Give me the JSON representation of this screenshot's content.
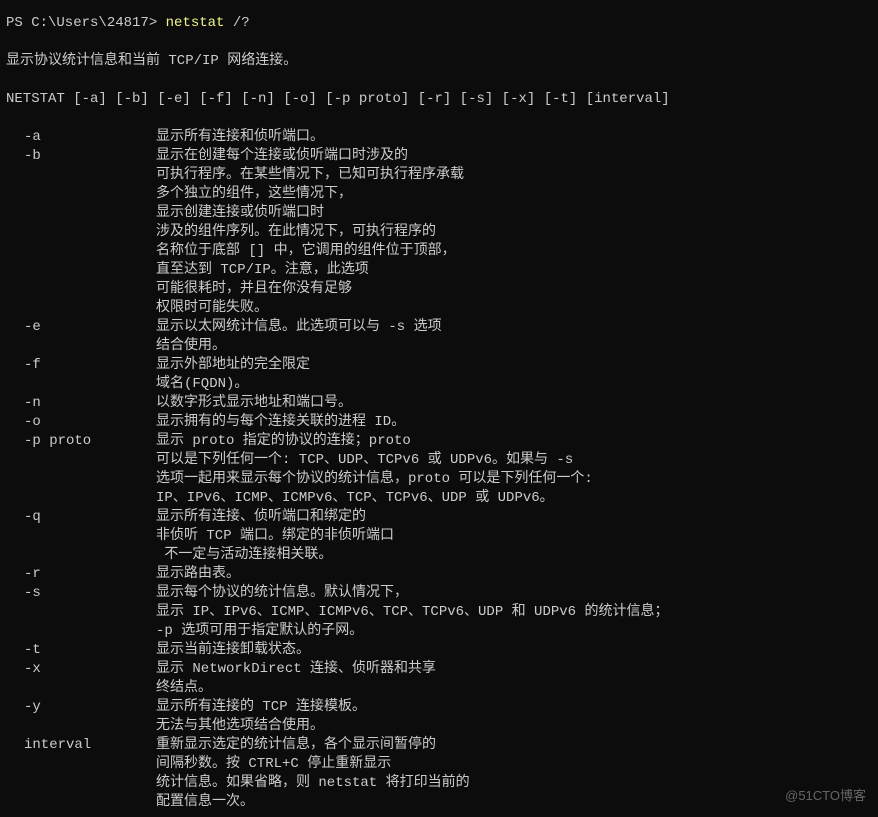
{
  "prompt": {
    "prefix": "PS C:\\Users\\24817> ",
    "command": "netstat",
    "args": " /?"
  },
  "summary": "显示协议统计信息和当前 TCP/IP 网络连接。",
  "usage": "NETSTAT [-a] [-b] [-e] [-f] [-n] [-o] [-p proto] [-r] [-s] [-x] [-t] [interval]",
  "options": {
    "a": {
      "flag": "-a",
      "lines": [
        "显示所有连接和侦听端口。"
      ]
    },
    "b": {
      "flag": "-b",
      "lines": [
        "显示在创建每个连接或侦听端口时涉及的",
        "可执行程序。在某些情况下，已知可执行程序承载",
        "多个独立的组件，这些情况下，",
        "显示创建连接或侦听端口时",
        "涉及的组件序列。在此情况下，可执行程序的",
        "名称位于底部 [] 中，它调用的组件位于顶部，",
        "直至达到 TCP/IP。注意，此选项",
        "可能很耗时，并且在你没有足够",
        "权限时可能失败。"
      ]
    },
    "e": {
      "flag": "-e",
      "lines": [
        "显示以太网统计信息。此选项可以与 -s 选项",
        "结合使用。"
      ]
    },
    "f": {
      "flag": "-f",
      "lines": [
        "显示外部地址的完全限定",
        "域名(FQDN)。"
      ]
    },
    "n": {
      "flag": "-n",
      "lines": [
        "以数字形式显示地址和端口号。"
      ]
    },
    "o": {
      "flag": "-o",
      "lines": [
        "显示拥有的与每个连接关联的进程 ID。"
      ]
    },
    "p": {
      "flag": "-p proto",
      "lines": [
        "显示 proto 指定的协议的连接；proto",
        "可以是下列任何一个: TCP、UDP、TCPv6 或 UDPv6。如果与 -s",
        "选项一起用来显示每个协议的统计信息，proto 可以是下列任何一个:",
        "IP、IPv6、ICMP、ICMPv6、TCP、TCPv6、UDP 或 UDPv6。"
      ]
    },
    "q": {
      "flag": "-q",
      "lines": [
        "显示所有连接、侦听端口和绑定的",
        "非侦听 TCP 端口。绑定的非侦听端口",
        " 不一定与活动连接相关联。"
      ]
    },
    "r": {
      "flag": "-r",
      "lines": [
        "显示路由表。"
      ]
    },
    "s": {
      "flag": "-s",
      "lines": [
        "显示每个协议的统计信息。默认情况下，",
        "显示 IP、IPv6、ICMP、ICMPv6、TCP、TCPv6、UDP 和 UDPv6 的统计信息；",
        "-p 选项可用于指定默认的子网。"
      ]
    },
    "t": {
      "flag": "-t",
      "lines": [
        "显示当前连接卸载状态。"
      ]
    },
    "x": {
      "flag": "-x",
      "lines": [
        "显示 NetworkDirect 连接、侦听器和共享",
        "终结点。"
      ]
    },
    "y": {
      "flag": "-y",
      "lines": [
        "显示所有连接的 TCP 连接模板。",
        "无法与其他选项结合使用。"
      ]
    },
    "interval": {
      "flag": "interval",
      "lines": [
        "重新显示选定的统计信息，各个显示间暂停的",
        "间隔秒数。按 CTRL+C 停止重新显示",
        "统计信息。如果省略，则 netstat 将打印当前的",
        "配置信息一次。"
      ]
    }
  },
  "watermark": "@51CTO博客"
}
